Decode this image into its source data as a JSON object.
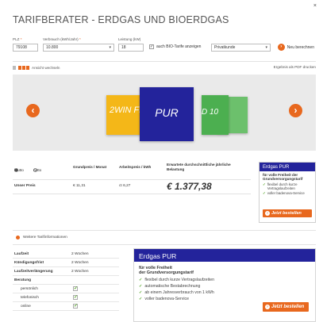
{
  "header": {
    "title": "TARIFBERATER - ERDGAS UND BIOERDGAS",
    "close": "×"
  },
  "form": {
    "plz_label": "PLZ",
    "plz_required": "*",
    "plz_value": "79108",
    "verbrauch_label": "Verbrauch (kWh/Jahr)",
    "verbrauch_required": "*",
    "verbrauch_value": "10.800",
    "leistung_label": "Leistung (kW)",
    "leistung_value": "18",
    "bio_label": "auch BIO-Tarife anzeigen",
    "bio_checked": "✓",
    "kunde_value": "Privatkunde",
    "neu_label": "Neu berechnen"
  },
  "viewbar": {
    "toggle_label": "Ansicht wechseln",
    "pdf_label": "Ergebnis als PDF drucken"
  },
  "carousel": {
    "cards": {
      "yellow": "2WIN FL",
      "blue": "PUR",
      "green": "D 10",
      "green2": "00"
    },
    "prev": "‹",
    "next": "›"
  },
  "table": {
    "brutto": "brutto",
    "netto": "netto",
    "col_grundpreis": "Grundpreis / Monat",
    "col_arbeitspreis": "Arbeitspreis / kWh",
    "col_jahres": "Erwartete durchschnittliche jährliche Belastung",
    "row_label": "Unser Preis",
    "grundpreis": "€ 11,31",
    "arbeitspreis": "ct 6,27",
    "jahres": "€ 1.377,38"
  },
  "sidebox": {
    "title": "Erdgas PUR",
    "subtitle": "für volle Freiheit der Grundversorgungstarif",
    "items": [
      "flexibel durch kurze Vertragslaufzeiten",
      "voller badenova-Service"
    ],
    "button": "Jetzt bestellen"
  },
  "more": {
    "label": "Weitere Tarifinformationen"
  },
  "details": {
    "rows": [
      {
        "k": "Laufzeit",
        "v": "2 Wochen"
      },
      {
        "k": "Kündigungsfrist",
        "v": "2 Wochen"
      },
      {
        "k": "Laufzeitverlängerung",
        "v": "2 Wochen"
      },
      {
        "k": "Beratung",
        "v": ""
      }
    ],
    "beratung": [
      "persönlich",
      "telefonisch",
      "online"
    ]
  },
  "panel": {
    "title": "Erdgas PUR",
    "subtitle_1": "für volle Freiheit",
    "subtitle_2": "der Grundversorgungstarif",
    "items": [
      "flexibel durch kurze Vertragslaufzeiten",
      "automatische Bestabrechnung",
      "ab einem Jahresverbrauch von 1 kWh",
      "voller badenova-Service"
    ],
    "button": "Jetzt bestellen"
  },
  "colors": {
    "accent": "#e8681e",
    "brand": "#23239b",
    "check": "#5aa92e"
  }
}
